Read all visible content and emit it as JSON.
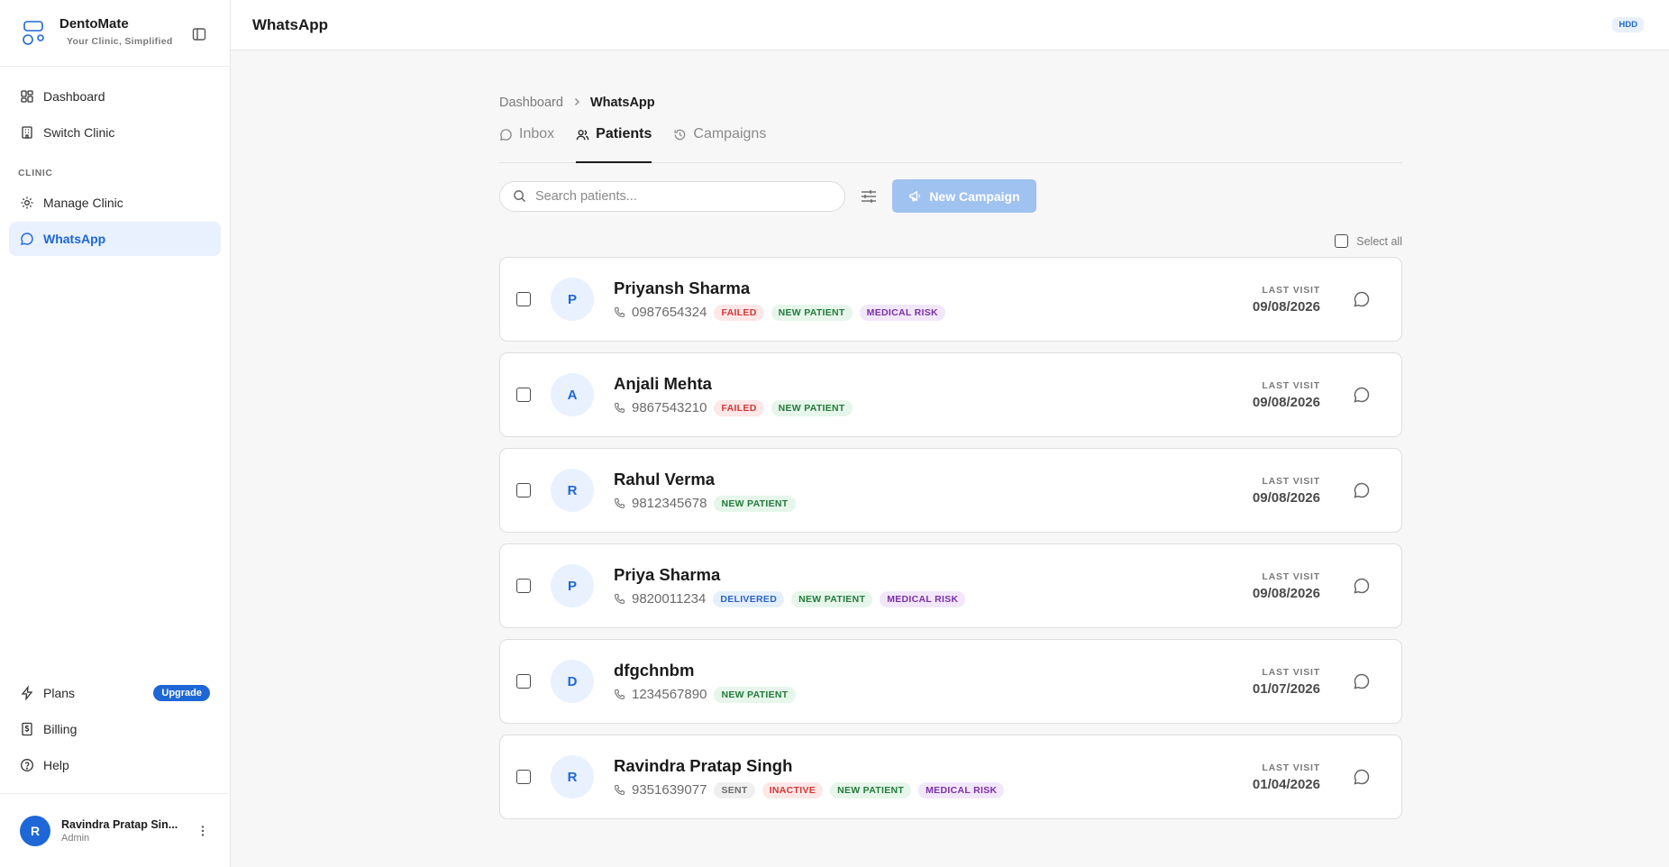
{
  "brand": {
    "name": "DentoMate",
    "tagline": "Your Clinic, Simplified"
  },
  "sidebar": {
    "items": [
      {
        "label": "Dashboard",
        "icon": "dashboard-icon"
      },
      {
        "label": "Switch Clinic",
        "icon": "building-icon"
      }
    ],
    "section_label": "CLINIC",
    "clinic_items": [
      {
        "label": "Manage Clinic",
        "icon": "gear-icon"
      },
      {
        "label": "WhatsApp",
        "icon": "chat-icon",
        "active": true
      }
    ],
    "bottom_items": [
      {
        "label": "Plans",
        "icon": "lightning-icon",
        "badge": "Upgrade"
      },
      {
        "label": "Billing",
        "icon": "billing-icon"
      },
      {
        "label": "Help",
        "icon": "help-icon"
      }
    ]
  },
  "user": {
    "initial": "R",
    "name": "Ravindra Pratap Sin...",
    "role": "Admin"
  },
  "topbar": {
    "title": "WhatsApp",
    "badge": "HDD"
  },
  "breadcrumb": {
    "parent": "Dashboard",
    "current": "WhatsApp"
  },
  "tabs": [
    {
      "label": "Inbox",
      "icon": "chat-icon"
    },
    {
      "label": "Patients",
      "icon": "users-icon",
      "active": true
    },
    {
      "label": "Campaigns",
      "icon": "history-icon"
    }
  ],
  "search": {
    "placeholder": "Search patients...",
    "value": ""
  },
  "toolbar": {
    "new_campaign_label": "New Campaign"
  },
  "select_all_label": "Select all",
  "last_visit_label": "LAST VISIT",
  "patients": [
    {
      "initial": "P",
      "name": "Priyansh Sharma",
      "phone": "0987654324",
      "tags": [
        "FAILED",
        "NEW PATIENT",
        "MEDICAL RISK"
      ],
      "last_visit": "09/08/2026"
    },
    {
      "initial": "A",
      "name": "Anjali Mehta",
      "phone": "9867543210",
      "tags": [
        "FAILED",
        "NEW PATIENT"
      ],
      "last_visit": "09/08/2026"
    },
    {
      "initial": "R",
      "name": "Rahul Verma",
      "phone": "9812345678",
      "tags": [
        "NEW PATIENT"
      ],
      "last_visit": "09/08/2026"
    },
    {
      "initial": "P",
      "name": "Priya Sharma",
      "phone": "9820011234",
      "tags": [
        "DELIVERED",
        "NEW PATIENT",
        "MEDICAL RISK"
      ],
      "last_visit": "09/08/2026"
    },
    {
      "initial": "D",
      "name": "dfgchnbm",
      "phone": "1234567890",
      "tags": [
        "NEW PATIENT"
      ],
      "last_visit": "01/07/2026"
    },
    {
      "initial": "R",
      "name": "Ravindra Pratap Singh",
      "phone": "9351639077",
      "tags": [
        "SENT",
        "INACTIVE",
        "NEW PATIENT",
        "MEDICAL RISK"
      ],
      "last_visit": "01/04/2026"
    }
  ],
  "colors": {
    "accent": "#1e67d6",
    "accent_light": "#e8f1fd",
    "button_disabled": "#9fc2f0"
  }
}
